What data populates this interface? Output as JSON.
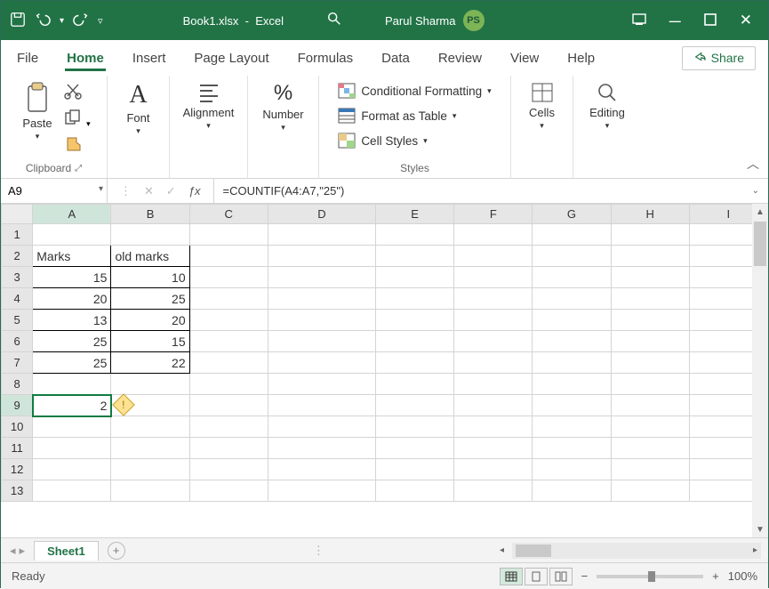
{
  "titlebar": {
    "doc": "Book1.xlsx",
    "app": "Excel",
    "user_name": "Parul Sharma",
    "user_initials": "PS"
  },
  "tabs": {
    "file": "File",
    "home": "Home",
    "insert": "Insert",
    "page_layout": "Page Layout",
    "formulas": "Formulas",
    "data": "Data",
    "review": "Review",
    "view": "View",
    "help": "Help",
    "share": "Share"
  },
  "ribbon": {
    "paste": "Paste",
    "clipboard": "Clipboard",
    "font": "Font",
    "alignment": "Alignment",
    "number": "Number",
    "cond_fmt": "Conditional Formatting",
    "fmt_table": "Format as Table",
    "cell_styles": "Cell Styles",
    "styles": "Styles",
    "cells": "Cells",
    "editing": "Editing"
  },
  "formula": {
    "name_box": "A9",
    "value": "=COUNTIF(A4:A7,\"25\")"
  },
  "columns": [
    "A",
    "B",
    "C",
    "D",
    "E",
    "F",
    "G",
    "H",
    "I"
  ],
  "rows": [
    "1",
    "2",
    "3",
    "4",
    "5",
    "6",
    "7",
    "8",
    "9",
    "10",
    "11",
    "12",
    "13"
  ],
  "cells": {
    "A2": "Marks",
    "B2": "old marks",
    "A3": "15",
    "B3": "10",
    "A4": "20",
    "B4": "25",
    "A5": "13",
    "B5": "20",
    "A6": "25",
    "B6": "15",
    "A7": "25",
    "B7": "22",
    "A9": "2"
  },
  "sheet": {
    "name": "Sheet1"
  },
  "statusbar": {
    "ready": "Ready",
    "zoom_pct": "100%"
  }
}
